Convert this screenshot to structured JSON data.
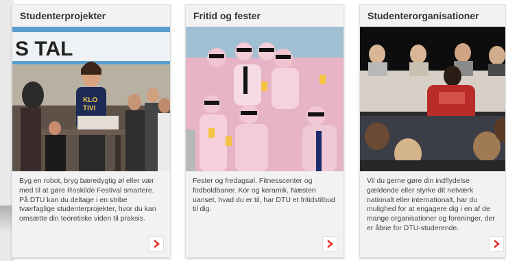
{
  "cards": [
    {
      "title": "Studenterprojekter",
      "text": "Byg en robot, bryg bæredygtig øl eller vær med til at gøre Roskilde Festival smartere. På DTU kan du deltage i en stribe tværfaglige studenterprojekter, hvor du kan omsætte din teoretiske viden til praksis.",
      "banner_text": "S  TAL",
      "shirt_text": "KLO\nTIVI",
      "arrow": "chevron-right-icon"
    },
    {
      "title": "Fritid og fester",
      "text": "Fester og fredagsøl. Fitnesscenter og fodboldbaner. Kor og keramik. Næsten uanset, hvad du er til, har DTU et fritidstilbud til dig.",
      "arrow": "chevron-right-icon"
    },
    {
      "title": "Studenterorganisationer",
      "text": "Vil du gerne gøre din indflydelse gældende eller styrke dit netværk nationalt eller internationalt, har du mulighed for at engagere dig i en af de mange organisationer og foreninger, der er åbne for DTU-studerende.",
      "arrow": "chevron-right-icon"
    }
  ],
  "colors": {
    "accent": "#e0322a",
    "card_bg": "#f2f2f2",
    "title_text": "#333333"
  }
}
